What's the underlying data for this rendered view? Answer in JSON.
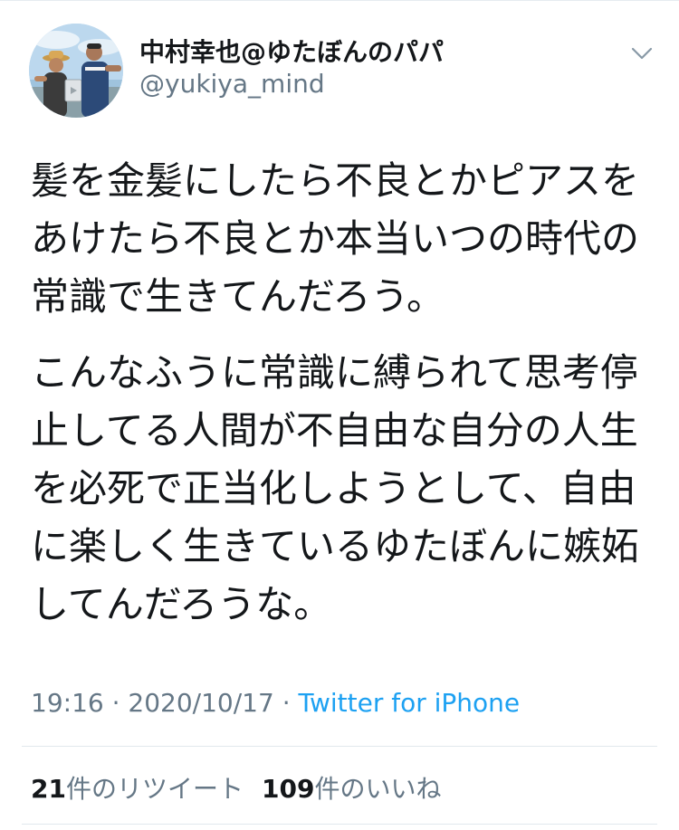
{
  "tweet": {
    "author": {
      "display_name": "中村幸也@ゆたぼんのパパ",
      "handle": "@yukiya_mind"
    },
    "paragraphs": [
      "髪を金髪にしたら不良とかピアスを\nあけたら不良とか本当いつの時代の\n常識で生きてんだろう。",
      "こんなふうに常識に縛られて思考停\n止してる人間が不自由な自分の人生\nを必死で正当化しようとして、自由\nに楽しく生きているゆたぼんに嫉妬\nしてんだろうな。"
    ],
    "meta": {
      "time": "19:16",
      "separator": " · ",
      "date": "2020/10/17",
      "source": "Twitter for iPhone"
    },
    "stats": {
      "retweets_count": "21",
      "retweets_label": "件のリツイート",
      "likes_count": "109",
      "likes_label": "件のいいね"
    }
  },
  "colors": {
    "text": "#14171a",
    "secondary": "#657786",
    "link": "#1da1f2",
    "divider": "#e1e8ed"
  },
  "icons": {
    "avatar": "profile-photo",
    "menu": "chevron-down-icon"
  }
}
